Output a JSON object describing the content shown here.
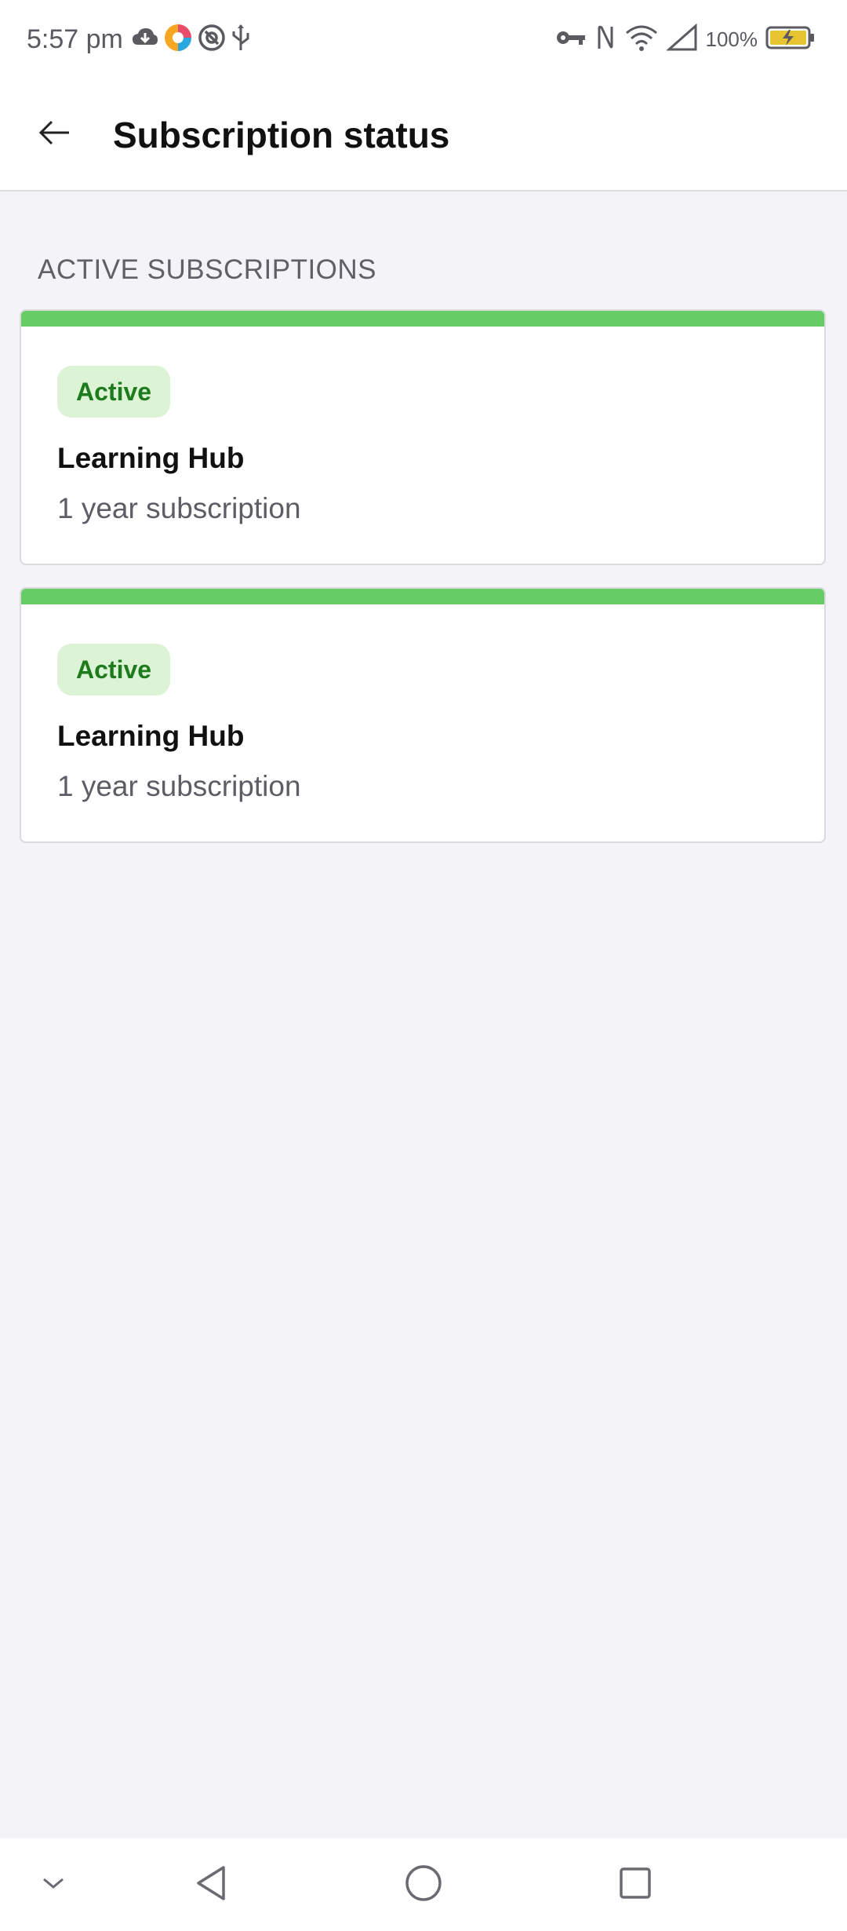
{
  "status_bar": {
    "time": "5:57 pm",
    "left_icons": [
      "cloud-download-icon",
      "app-colorful-icon",
      "at-sign-icon",
      "usb-icon"
    ],
    "right_icons": [
      "vpn-key-icon",
      "nfc-icon",
      "wifi-icon",
      "cellular-signal-icon"
    ],
    "battery_percent": "100%",
    "battery_icon": "battery-charging-icon"
  },
  "app_bar": {
    "back_icon": "arrow-left-icon",
    "title": "Subscription status"
  },
  "section": {
    "header": "ACTIVE SUBSCRIPTIONS"
  },
  "subscriptions": [
    {
      "status": "Active",
      "name": "Learning Hub",
      "plan": "1 year subscription"
    },
    {
      "status": "Active",
      "name": "Learning Hub",
      "plan": "1 year subscription"
    }
  ],
  "nav_bar": {
    "icons": [
      "chevron-down-icon",
      "back-triangle-icon",
      "home-circle-icon",
      "recents-square-icon"
    ]
  },
  "colors": {
    "accent_green": "#66cc66",
    "badge_bg": "#dcf3d6",
    "badge_text": "#1d7a1d",
    "background": "#f3f3f8"
  }
}
